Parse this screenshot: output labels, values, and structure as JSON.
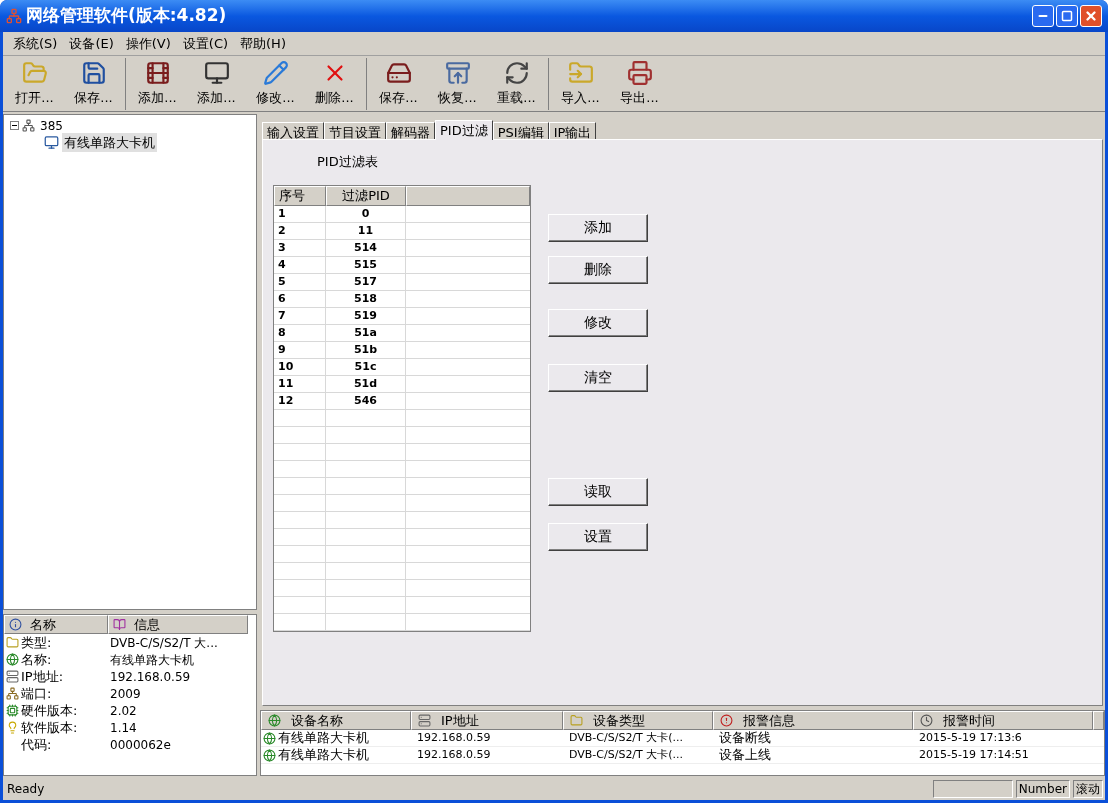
{
  "window": {
    "title": "网络管理软件(版本:4.82)"
  },
  "menu": [
    {
      "label": "系统(S)"
    },
    {
      "label": "设备(E)"
    },
    {
      "label": "操作(V)"
    },
    {
      "label": "设置(C)"
    },
    {
      "label": "帮助(H)"
    }
  ],
  "toolbar": [
    {
      "buttons": [
        {
          "label": "打开..."
        },
        {
          "label": "保存..."
        }
      ]
    },
    {
      "buttons": [
        {
          "label": "添加..."
        },
        {
          "label": "添加..."
        },
        {
          "label": "修改..."
        },
        {
          "label": "删除..."
        }
      ]
    },
    {
      "buttons": [
        {
          "label": "保存..."
        },
        {
          "label": "恢复..."
        },
        {
          "label": "重载..."
        }
      ]
    },
    {
      "buttons": [
        {
          "label": "导入..."
        },
        {
          "label": "导出..."
        }
      ]
    }
  ],
  "tree": [
    {
      "label": "385",
      "expanded": true,
      "selected": false,
      "children": [
        {
          "label": "有线单路大卡机",
          "selected": true
        }
      ]
    }
  ],
  "info": {
    "columns": [
      "名称",
      "信息"
    ],
    "rows": [
      {
        "name": "类型:",
        "value": "DVB-C/S/S2/T 大..."
      },
      {
        "name": "名称:",
        "value": "有线单路大卡机"
      },
      {
        "name": "IP地址:",
        "value": "192.168.0.59"
      },
      {
        "name": "端口:",
        "value": "2009"
      },
      {
        "name": "硬件版本:",
        "value": "2.02"
      },
      {
        "name": "软件版本:",
        "value": "1.14"
      },
      {
        "name": "代码:",
        "value": "0000062e"
      }
    ]
  },
  "tabs": [
    {
      "label": "输入设置",
      "selected": false
    },
    {
      "label": "节目设置",
      "selected": false
    },
    {
      "label": "解码器",
      "selected": false
    },
    {
      "label": "PID过滤",
      "selected": true
    },
    {
      "label": "PSI编辑",
      "selected": false
    },
    {
      "label": "IP输出",
      "selected": false
    }
  ],
  "pid_filter": {
    "title": "PID过滤表",
    "columns": [
      "序号",
      "过滤PID"
    ],
    "rows": [
      [
        "1",
        "0"
      ],
      [
        "2",
        "11"
      ],
      [
        "3",
        "514"
      ],
      [
        "4",
        "515"
      ],
      [
        "5",
        "517"
      ],
      [
        "6",
        "518"
      ],
      [
        "7",
        "519"
      ],
      [
        "8",
        "51a"
      ],
      [
        "9",
        "51b"
      ],
      [
        "10",
        "51c"
      ],
      [
        "11",
        "51d"
      ],
      [
        "12",
        "546"
      ]
    ],
    "buttons": [
      "添加",
      "删除",
      "修改",
      "清空",
      "读取",
      "设置"
    ]
  },
  "alarms": {
    "columns": [
      "设备名称",
      "IP地址",
      "设备类型",
      "报警信息",
      "报警时间"
    ],
    "rows": [
      [
        "有线单路大卡机",
        "192.168.0.59",
        "DVB-C/S/S2/T 大卡(...",
        "设备断线",
        "2015-5-19 17:13:6"
      ],
      [
        "有线单路大卡机",
        "192.168.0.59",
        "DVB-C/S/S2/T 大卡(...",
        "设备上线",
        "2015-5-19 17:14:51"
      ]
    ]
  },
  "status_bar": {
    "message": "Ready",
    "panes": [
      "Number",
      "滚动"
    ]
  }
}
